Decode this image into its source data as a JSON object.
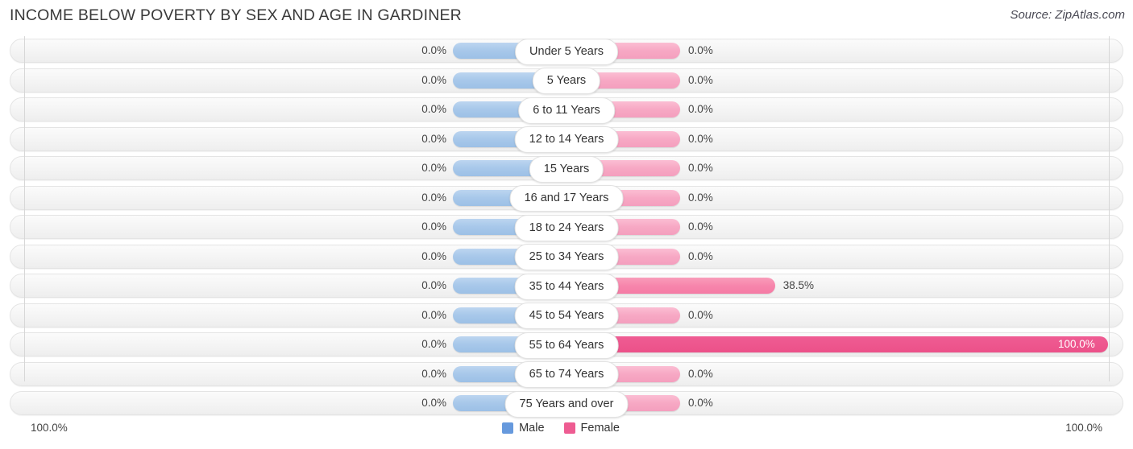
{
  "header": {
    "title": "INCOME BELOW POVERTY BY SEX AND AGE IN GARDINER",
    "source": "Source: ZipAtlas.com"
  },
  "axis": {
    "left_label": "100.0%",
    "right_label": "100.0%",
    "max": 100.0
  },
  "legend": {
    "items": [
      {
        "label": "Male",
        "color": "#6699DD"
      },
      {
        "label": "Female",
        "color": "#EE5C92"
      }
    ]
  },
  "colors": {
    "male_bar": "#A8C8EA",
    "female_zero": "#F7A8C4",
    "female_mid": "#F786AC",
    "female_full": "#EF5C93",
    "track": "#F4F4F4",
    "label_pill": "#FFFFFF",
    "text": "#454545"
  },
  "chart_data": {
    "type": "bar",
    "title": "INCOME BELOW POVERTY BY SEX AND AGE IN GARDINER",
    "subtitle": "Source: ZipAtlas.com",
    "orientation": "horizontal-diverging",
    "xlabel": "",
    "ylabel": "",
    "xlim": [
      0,
      100
    ],
    "grid": false,
    "legend_position": "bottom-center",
    "categories": [
      "Under 5 Years",
      "5 Years",
      "6 to 11 Years",
      "12 to 14 Years",
      "15 Years",
      "16 and 17 Years",
      "18 to 24 Years",
      "25 to 34 Years",
      "35 to 44 Years",
      "45 to 54 Years",
      "55 to 64 Years",
      "65 to 74 Years",
      "75 Years and over"
    ],
    "series": [
      {
        "name": "Male",
        "values": [
          0.0,
          0.0,
          0.0,
          0.0,
          0.0,
          0.0,
          0.0,
          0.0,
          0.0,
          0.0,
          0.0,
          0.0,
          0.0
        ],
        "labels": [
          "0.0%",
          "0.0%",
          "0.0%",
          "0.0%",
          "0.0%",
          "0.0%",
          "0.0%",
          "0.0%",
          "0.0%",
          "0.0%",
          "0.0%",
          "0.0%",
          "0.0%"
        ]
      },
      {
        "name": "Female",
        "values": [
          0.0,
          0.0,
          0.0,
          0.0,
          0.0,
          0.0,
          0.0,
          0.0,
          38.5,
          0.0,
          100.0,
          0.0,
          0.0
        ],
        "labels": [
          "0.0%",
          "0.0%",
          "0.0%",
          "0.0%",
          "0.0%",
          "0.0%",
          "0.0%",
          "0.0%",
          "38.5%",
          "0.0%",
          "100.0%",
          "0.0%",
          "0.0%"
        ]
      }
    ]
  }
}
